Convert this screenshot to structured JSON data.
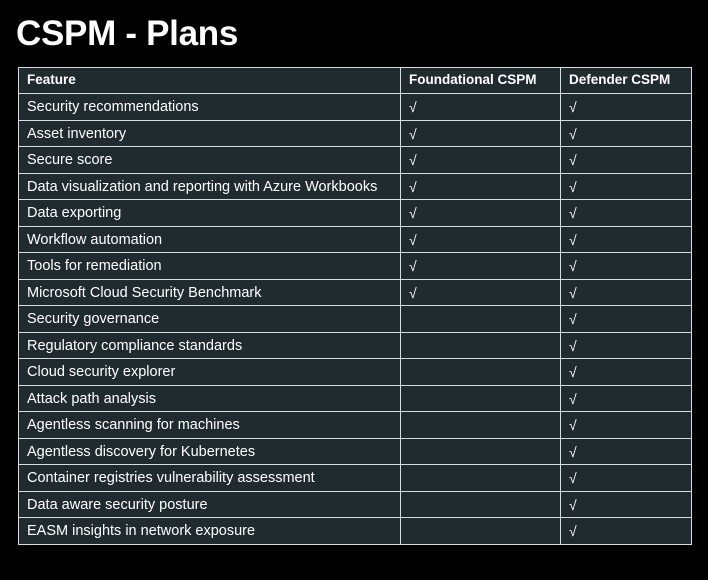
{
  "page": {
    "title": "CSPM - Plans"
  },
  "table": {
    "headers": [
      "Feature",
      "Foundational CSPM",
      "Defender CSPM"
    ],
    "rows": [
      {
        "feature": "Security recommendations",
        "foundational": "√",
        "defender": "√"
      },
      {
        "feature": "Asset inventory",
        "foundational": "√",
        "defender": "√"
      },
      {
        "feature": "Secure score",
        "foundational": "√",
        "defender": "√"
      },
      {
        "feature": "Data visualization and reporting with Azure Workbooks",
        "foundational": "√",
        "defender": "√"
      },
      {
        "feature": "Data exporting",
        "foundational": "√",
        "defender": "√"
      },
      {
        "feature": "Workflow automation",
        "foundational": "√",
        "defender": "√"
      },
      {
        "feature": "Tools for remediation",
        "foundational": "√",
        "defender": "√"
      },
      {
        "feature": "Microsoft Cloud Security Benchmark",
        "foundational": "√",
        "defender": "√"
      },
      {
        "feature": "Security governance",
        "foundational": "",
        "defender": "√"
      },
      {
        "feature": "Regulatory compliance standards",
        "foundational": "",
        "defender": "√"
      },
      {
        "feature": "Cloud security explorer",
        "foundational": "",
        "defender": "√"
      },
      {
        "feature": "Attack path analysis",
        "foundational": "",
        "defender": "√"
      },
      {
        "feature": "Agentless scanning for machines",
        "foundational": "",
        "defender": "√"
      },
      {
        "feature": "Agentless discovery for Kubernetes",
        "foundational": "",
        "defender": "√"
      },
      {
        "feature": "Container registries vulnerability assessment",
        "foundational": "",
        "defender": "√"
      },
      {
        "feature": "Data aware security posture",
        "foundational": "",
        "defender": "√"
      },
      {
        "feature": "EASM insights in network exposure",
        "foundational": "",
        "defender": "√"
      }
    ]
  },
  "colors": {
    "background": "#000000",
    "table_background": "#202b2f",
    "border": "#d7dcdf",
    "text": "#ffffff"
  }
}
